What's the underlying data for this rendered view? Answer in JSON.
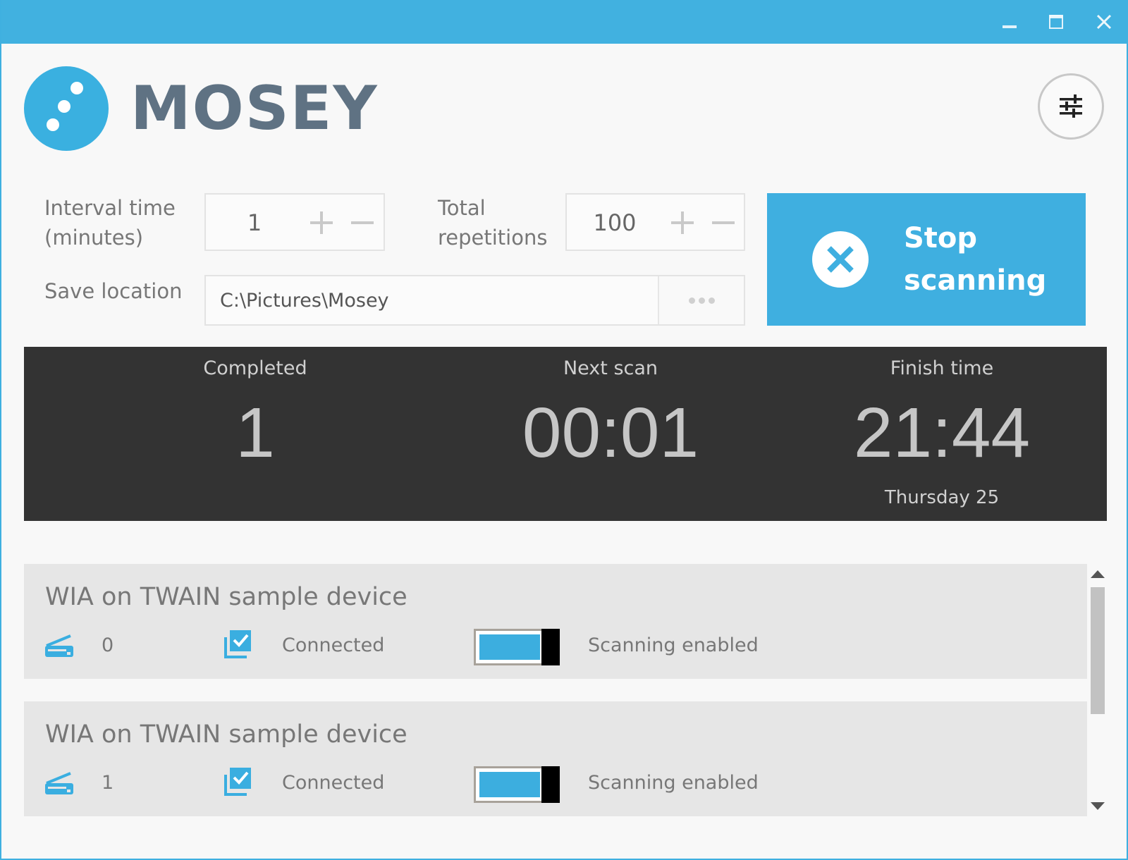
{
  "window": {
    "controls": [
      "minimize-icon",
      "maximize-icon",
      "close-icon"
    ]
  },
  "app": {
    "name": "MOSEY",
    "accent_color": "#41b1e0",
    "logo_color": "#3ab0e0"
  },
  "settings": {
    "icon": "sliders-icon"
  },
  "interval": {
    "label": "Interval time\n(minutes)",
    "value": "1"
  },
  "repetitions": {
    "label": "Total\nrepetitions",
    "value": "100"
  },
  "save_location": {
    "label": "Save location",
    "path": "C:\\Pictures\\Mosey",
    "browse_icon": "ellipsis-icon"
  },
  "stop_button": {
    "label": "Stop\nscanning",
    "icon": "close-circle-icon"
  },
  "stats": {
    "completed": {
      "label": "Completed",
      "value": "1"
    },
    "next_scan": {
      "label": "Next scan",
      "value": "00:01"
    },
    "finish_time": {
      "label": "Finish time",
      "value": "21:44",
      "day": "Thursday 25"
    }
  },
  "devices": [
    {
      "name": "WIA on TWAIN sample device",
      "count": "0",
      "status": "Connected",
      "scanning_label": "Scanning enabled",
      "scanning_enabled": true
    },
    {
      "name": "WIA on TWAIN sample device",
      "count": "1",
      "status": "Connected",
      "scanning_label": "Scanning enabled",
      "scanning_enabled": true
    }
  ]
}
